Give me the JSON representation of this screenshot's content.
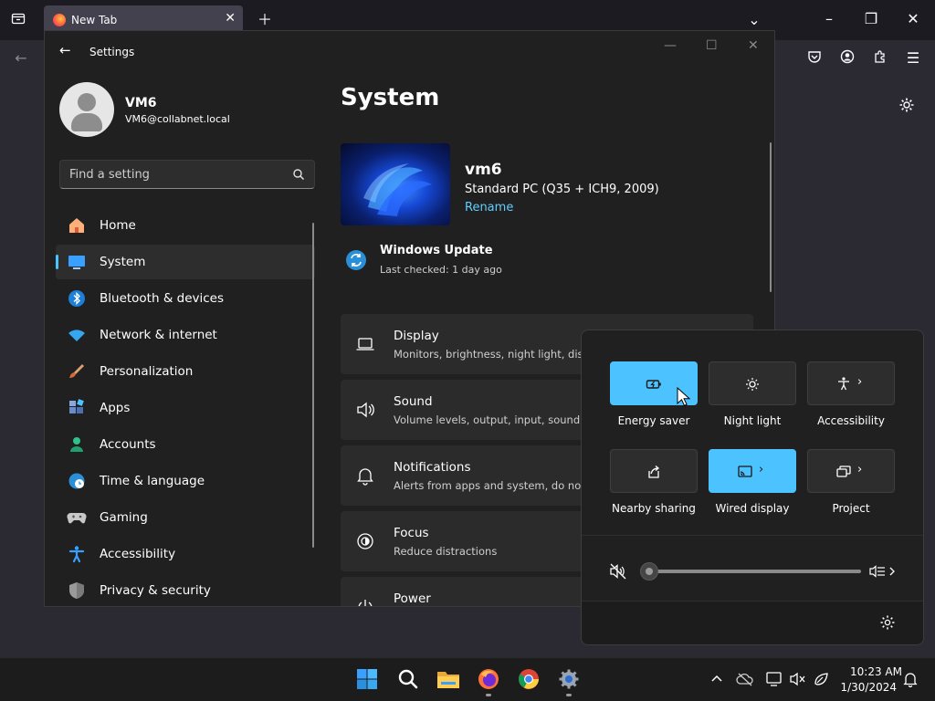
{
  "firefox": {
    "tab_title": "New Tab"
  },
  "settings": {
    "window_title": "Settings",
    "user": {
      "name": "VM6",
      "email": "VM6@collabnet.local"
    },
    "search_placeholder": "Find a setting",
    "nav": [
      {
        "label": "Home",
        "icon": "home-icon",
        "active": false
      },
      {
        "label": "System",
        "icon": "monitor-icon",
        "active": true
      },
      {
        "label": "Bluetooth & devices",
        "icon": "bluetooth-icon",
        "active": false
      },
      {
        "label": "Network & internet",
        "icon": "wifi-icon",
        "active": false
      },
      {
        "label": "Personalization",
        "icon": "brush-icon",
        "active": false
      },
      {
        "label": "Apps",
        "icon": "apps-icon",
        "active": false
      },
      {
        "label": "Accounts",
        "icon": "accounts-icon",
        "active": false
      },
      {
        "label": "Time & language",
        "icon": "globe-clock-icon",
        "active": false
      },
      {
        "label": "Gaming",
        "icon": "gamepad-icon",
        "active": false
      },
      {
        "label": "Accessibility",
        "icon": "accessibility-icon",
        "active": false
      },
      {
        "label": "Privacy & security",
        "icon": "shield-icon",
        "active": false
      }
    ],
    "page_title": "System",
    "pc": {
      "name": "vm6",
      "model": "Standard PC (Q35 + ICH9, 2009)",
      "rename": "Rename"
    },
    "windows_update": {
      "title": "Windows Update",
      "subtitle": "Last checked: 1 day ago"
    },
    "cards": [
      {
        "title": "Display",
        "subtitle": "Monitors, brightness, night light, displ",
        "icon": "laptop-icon"
      },
      {
        "title": "Sound",
        "subtitle": "Volume levels, output, input, sound de",
        "icon": "speaker-icon"
      },
      {
        "title": "Notifications",
        "subtitle": "Alerts from apps and system, do not d",
        "icon": "bell-icon"
      },
      {
        "title": "Focus",
        "subtitle": "Reduce distractions",
        "icon": "focus-icon"
      },
      {
        "title": "Power",
        "subtitle": "",
        "icon": "power-icon"
      }
    ]
  },
  "quick_settings": {
    "tiles": [
      {
        "label": "Energy saver",
        "on": true,
        "icon": "energy-saver-icon",
        "chevron": false
      },
      {
        "label": "Night light",
        "on": false,
        "icon": "night-light-icon",
        "chevron": false
      },
      {
        "label": "Accessibility",
        "on": false,
        "icon": "accessibility-icon",
        "chevron": true
      },
      {
        "label": "Nearby sharing",
        "on": false,
        "icon": "share-icon",
        "chevron": false
      },
      {
        "label": "Wired display",
        "on": true,
        "icon": "cast-icon",
        "chevron": true
      },
      {
        "label": "Project",
        "on": false,
        "icon": "project-icon",
        "chevron": true
      }
    ],
    "volume": 0
  },
  "taskbar": {
    "apps": [
      "windows-start-icon",
      "search-icon",
      "file-explorer-icon",
      "firefox-icon",
      "chrome-icon",
      "settings-icon"
    ],
    "time": "10:23 AM",
    "date": "1/30/2024"
  },
  "colors": {
    "accent": "#4cc2ff",
    "link": "#60cdff",
    "window_bg": "#202020"
  }
}
